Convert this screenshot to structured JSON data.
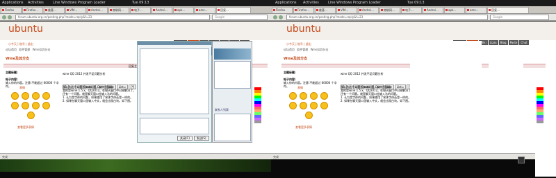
{
  "topbar": {
    "applications": "Applications",
    "activities": "Activities",
    "window_title": "Line Windows Program Loader",
    "clock": "Tue 09:13",
    "tray_right": "▾"
  },
  "browser": {
    "title": "回复主题 | 讨论区 | Ubuntu中文 - Mozilla Firefox",
    "tabs": [
      "Firefox",
      "Firefox…",
      "维基…",
      "VIM…",
      "Androi…",
      "物联网…",
      "电子…",
      "Androi…",
      "apk…",
      "amz…",
      "回复…"
    ],
    "url": "forum.ubuntu.org.cn/posting.php?mode=reply&f=23",
    "search_placeholder": "Google"
  },
  "forum": {
    "logo": "ubuntu",
    "logo_sub": "中文论坛",
    "menu": [
      "Ubuntu",
      "Forum",
      "Wiki",
      "Lizas",
      "Blog",
      "Paste",
      "Chat"
    ],
    "user_line": "小今天 | 账号 | 退出",
    "crumbs": [
      "论坛首页",
      "软件管理",
      "Wine及其分支"
    ],
    "page_title": "Wine及其分支",
    "reply_bar": "回复主题",
    "subject_label": "主题标题:",
    "body_label": "帖子内容:",
    "body_hint": "输入你的内容。注意:不能超过 60000 个字符。",
    "smilies_label": "表情",
    "more_smilies": "查看更多表情",
    "subject_value": "wine QQ 2012 并发不足问题分析",
    "toolbar": [
      "B",
      "i",
      "u",
      "Quote",
      "Code",
      "List",
      "List=",
      "[*]",
      "Img",
      "URL"
    ],
    "editor_lines": [
      "我认为这个问题是字体问题，发个图看看:",
      "我的是wine 1.5.x，QQ2012。在聊天窗口中已经解决了。",
      "还有一个问题。就是聊天窗口会输入法的问题。",
      "1. 认为是字体的问题，如果使用了宋体字体还是一样的。",
      "2. 如果在聊天窗口里输入中文，就会出现白块。如下图。"
    ]
  },
  "chat": {
    "send_label": "发送(S)",
    "close_label": "关闭(C)",
    "side_label": "联系人列表"
  },
  "statusbar": "完成",
  "colors": {
    "accent": "#c64a1a",
    "menu_bg": "#555555"
  }
}
